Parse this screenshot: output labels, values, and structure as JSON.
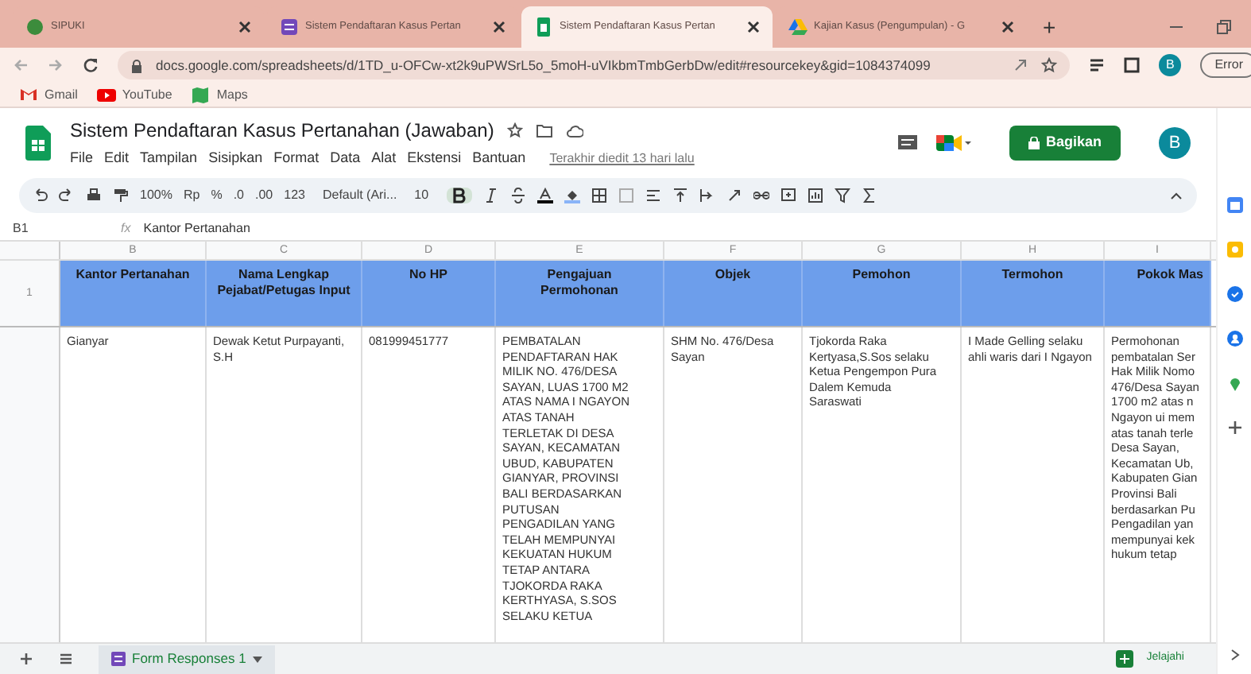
{
  "browser_tabs": [
    {
      "title": "SIPUKI",
      "selected": false
    },
    {
      "title": "Sistem Pendaftaran Kasus Pertan",
      "selected": false
    },
    {
      "title": "Sistem Pendaftaran Kasus Pertan",
      "selected": true
    },
    {
      "title": "Kajian Kasus (Pengumpulan) - G",
      "selected": false
    }
  ],
  "new_tab": "+",
  "address": "docs.google.com/spreadsheets/d/1TD_u-OFCw-xt2k9uPWSrL5o_5moH-uVIkbmTmbGerbDw/edit#resourcekey&gid=1084374099",
  "profile": "B",
  "error_button": "Error",
  "bookmarks": [
    {
      "label": "Gmail"
    },
    {
      "label": "YouTube"
    },
    {
      "label": "Maps"
    }
  ],
  "doc": {
    "title": "Sistem Pendaftaran Kasus Pertanahan (Jawaban)",
    "menus": [
      "File",
      "Edit",
      "Tampilan",
      "Sisipkan",
      "Format",
      "Data",
      "Alat",
      "Ekstensi",
      "Bantuan"
    ],
    "last_edit": "Terakhir diedit 13 hari lalu",
    "share": "Bagikan",
    "avatar": "B"
  },
  "toolbar": {
    "zoom": "100%",
    "currency": "Rp",
    "percent": "%",
    "dec_less": ".0",
    "dec_more": ".00",
    "number_format": "123",
    "font": "Default (Ari...",
    "size": "10",
    "bold_on": true
  },
  "formula_bar": {
    "cell": "B1",
    "fx": "fx",
    "value": "Kantor Pertanahan"
  },
  "columns": [
    "B",
    "C",
    "D",
    "E",
    "F",
    "G",
    "H",
    "I"
  ],
  "header_row": {
    "number": "1",
    "cells": [
      "Kantor Pertanahan",
      "Nama Lengkap\nPejabat/Petugas Input",
      "No HP",
      "Pengajuan\nPermohonan",
      "Objek",
      "Pemohon",
      "Termohon",
      "Pokok Mas"
    ]
  },
  "data_row": {
    "cells": [
      "Gianyar",
      "Dewak Ketut Purpayanti,\nS.H",
      "081999451777",
      "PEMBATALAN\nPENDAFTARAN HAK\nMILIK NO. 476/DESA\nSAYAN, LUAS 1700 M2\nATAS NAMA I NGAYON\nATAS TANAH\nTERLETAK DI DESA\nSAYAN, KECAMATAN\nUBUD, KABUPATEN\nGIANYAR, PROVINSI\nBALI BERDASARKAN\nPUTUSAN\nPENGADILAN YANG\nTELAH MEMPUNYAI\nKEKUATAN HUKUM\nTETAP ANTARA\nTJOKORDA RAKA\nKERTHYASA, S.SOS\nSELAKU KETUA",
      "SHM No. 476/Desa\nSayan",
      "Tjokorda Raka\nKertyasa,S.Sos selaku\nKetua Pengempon Pura\nDalem Kemuda\nSaraswati",
      "I Made Gelling selaku\nahli waris dari I Ngayon",
      "Permohonan\npembatalan Ser\nHak Milik Nomo\n476/Desa Sayan\n1700 m2 atas n\nNgayon ui mem\natas tanah terle\nDesa Sayan,\nKecamatan Ub,\nKabupaten Gian\nProvinsi Bali\nberdasarkan Pu\nPengadilan yan\nmempunyai kek\nhukum tetap"
    ]
  },
  "sheet_tabs": [
    {
      "label": "Form Responses 1",
      "selected": true
    }
  ],
  "explore": "Jelajahi"
}
